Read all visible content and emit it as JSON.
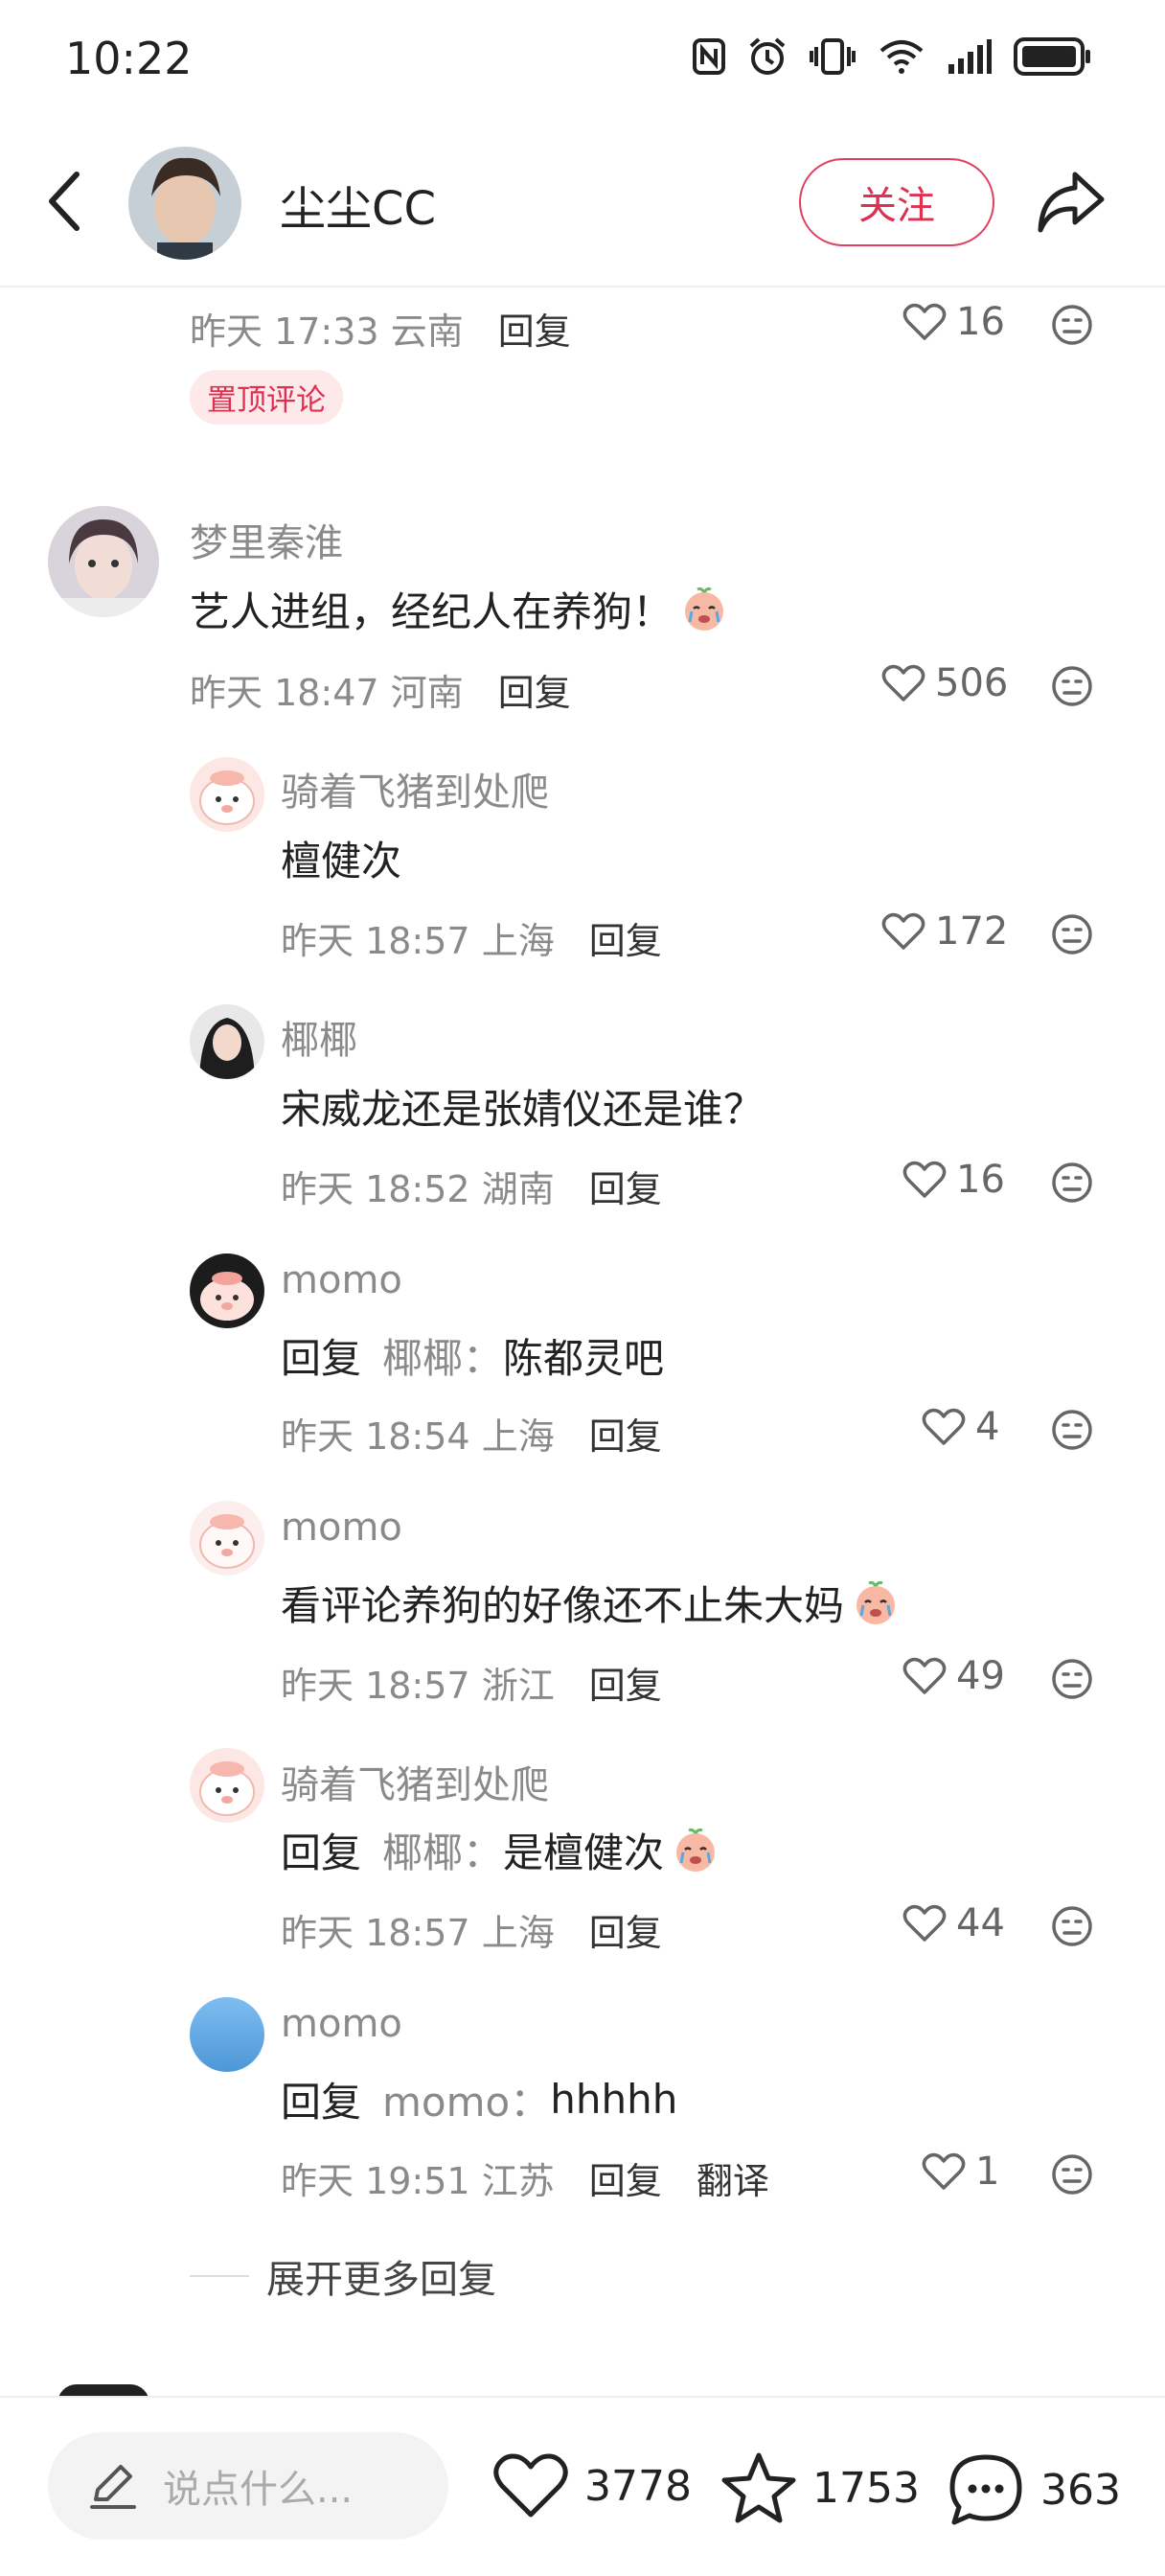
{
  "status_bar": {
    "time": "10:22",
    "icons": [
      "nfc-icon",
      "alarm-icon",
      "vibrate-icon",
      "wifi-icon",
      "signal-icon",
      "battery-icon"
    ]
  },
  "header": {
    "author_name": "尘尘CC",
    "follow_label": "关注"
  },
  "pinned_comment": {
    "time": "昨天 17:33",
    "location": "云南",
    "reply_label": "回复",
    "likes": "16",
    "badge": "置顶评论"
  },
  "comment": {
    "username": "梦里秦淮",
    "text": "艺人进组，经纪人在养狗！",
    "time": "昨天 18:47",
    "location": "河南",
    "reply_label": "回复",
    "likes": "506"
  },
  "replies": [
    {
      "username": "骑着飞猪到处爬",
      "text": "檀健次",
      "reply_to": "",
      "time": "昨天 18:57",
      "location": "上海",
      "reply_label": "回复",
      "likes": "172"
    },
    {
      "username": "椰椰",
      "text": "宋威龙还是张婧仪还是谁？",
      "reply_to": "",
      "time": "昨天 18:52",
      "location": "湖南",
      "reply_label": "回复",
      "likes": "16"
    },
    {
      "username": "momo",
      "prefix": "回复",
      "reply_to": "椰椰：",
      "text": "陈都灵吧",
      "time": "昨天 18:54",
      "location": "上海",
      "reply_label": "回复",
      "likes": "4"
    },
    {
      "username": "momo",
      "text": "看评论养狗的好像还不止朱大妈",
      "reply_to": "",
      "time": "昨天 18:57",
      "location": "浙江",
      "reply_label": "回复",
      "likes": "49"
    },
    {
      "username": "骑着飞猪到处爬",
      "prefix": "回复",
      "reply_to": "椰椰：",
      "text": "是檀健次",
      "time": "昨天 18:57",
      "location": "上海",
      "reply_label": "回复",
      "likes": "44"
    },
    {
      "username": "momo",
      "prefix": "回复",
      "reply_to": "momo：",
      "text": "hhhhh",
      "time": "昨天 19:51",
      "location": "江苏",
      "reply_label": "回复",
      "translate_label": "翻译",
      "likes": "1"
    }
  ],
  "more_replies_label": "展开更多回复",
  "bottom_bar": {
    "input_placeholder": "说点什么...",
    "likes": "3778",
    "stars": "1753",
    "comments": "363"
  },
  "colors": {
    "accent": "#e03050",
    "badge_bg": "#fde8ea",
    "meta_text": "#8a8a8a"
  }
}
